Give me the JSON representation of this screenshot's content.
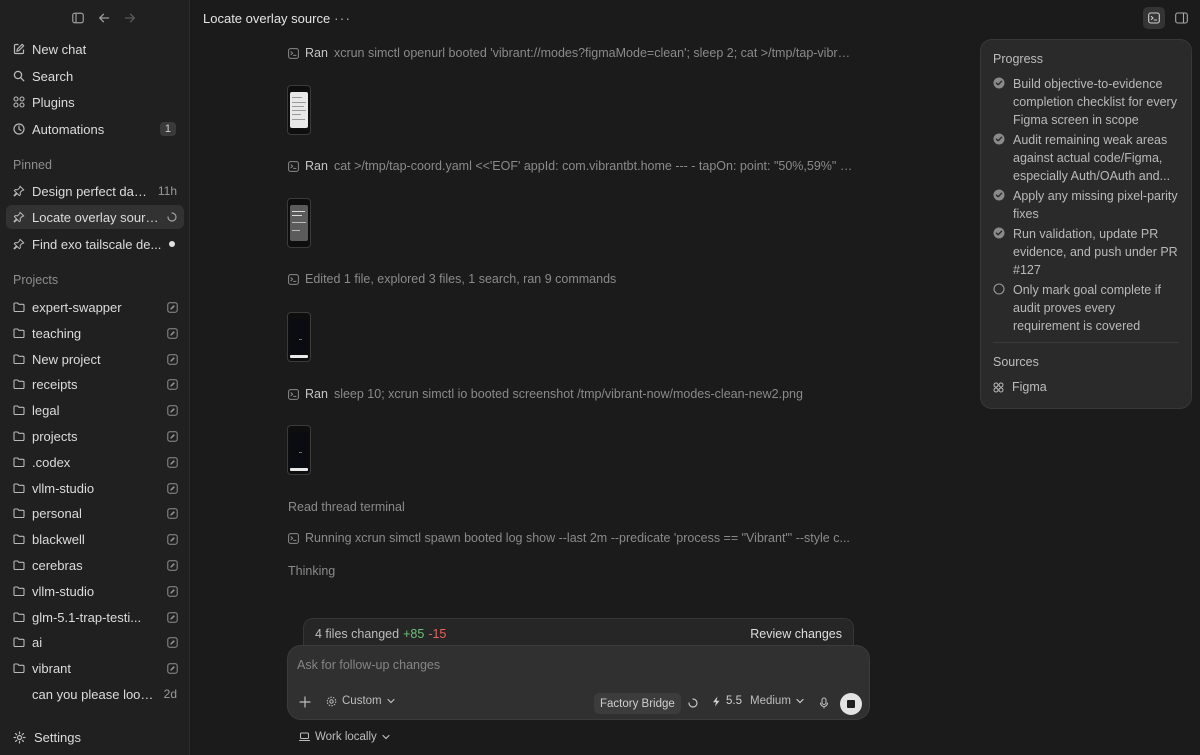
{
  "window": {
    "title": "Locate overlay source"
  },
  "sidebar": {
    "new_chat": "New chat",
    "search": "Search",
    "plugins": "Plugins",
    "automations": "Automations",
    "automations_count": "1",
    "pinned_label": "Pinned",
    "pinned": [
      {
        "label": "Design perfect dash...",
        "meta": "11h"
      },
      {
        "label": "Locate overlay source",
        "meta": ""
      },
      {
        "label": "Find exo tailscale de...",
        "meta": ""
      }
    ],
    "projects_label": "Projects",
    "projects": [
      "expert-swapper",
      "teaching",
      "New project",
      "receipts",
      "legal",
      "projects",
      ".codex",
      "vllm-studio",
      "personal",
      "blackwell",
      "cerebras",
      "vllm-studio",
      "glm-5.1-trap-testi...",
      "ai",
      "vibrant"
    ],
    "thread": {
      "label": "can you please look ...",
      "meta": "2d"
    },
    "settings": "Settings"
  },
  "log": [
    {
      "verb": "Ran",
      "cmd": "xcrun simctl openurl booted 'vibrant://modes?figmaMode=clean'; sleep 2; cat >/tmp/tap-vibran..."
    },
    {
      "verb": "Ran",
      "cmd": "cat >/tmp/tap-coord.yaml <<'EOF' appId: com.vibrantbt.home --- - tapOn: point: \"50%,59%\" E..."
    },
    {
      "verb": "",
      "cmd": "Edited 1 file, explored 3 files, 1 search, ran 9 commands"
    },
    {
      "verb": "Ran",
      "cmd": "sleep 10; xcrun simctl io booted screenshot /tmp/vibrant-now/modes-clean-new2.png"
    },
    {
      "verb": "",
      "cmd": "Running xcrun simctl spawn booted log show --last 2m --predicate 'process == \"Vibrant\"' --style c..."
    }
  ],
  "status": {
    "read_terminal": "Read thread terminal",
    "thinking": "Thinking"
  },
  "progress": {
    "title": "Progress",
    "items": [
      {
        "text": "Build objective-to-evidence completion checklist for every Figma screen in scope",
        "done": true
      },
      {
        "text": "Audit remaining weak areas against actual code/Figma, especially Auth/OAuth and...",
        "done": true
      },
      {
        "text": "Apply any missing pixel-parity fixes",
        "done": true
      },
      {
        "text": "Run validation, update PR evidence, and push under PR #127",
        "done": true
      },
      {
        "text": "Only mark goal complete if audit proves every requirement is covered",
        "done": false
      }
    ],
    "sources_label": "Sources",
    "source": "Figma"
  },
  "changes": {
    "summary": "4 files changed",
    "added": "+85",
    "removed": "-15",
    "review": "Review changes"
  },
  "composer": {
    "placeholder": "Ask for follow-up changes",
    "mode": "Custom",
    "bridge": "Factory Bridge",
    "model": "5.5",
    "effort": "Medium",
    "work": "Work locally"
  }
}
